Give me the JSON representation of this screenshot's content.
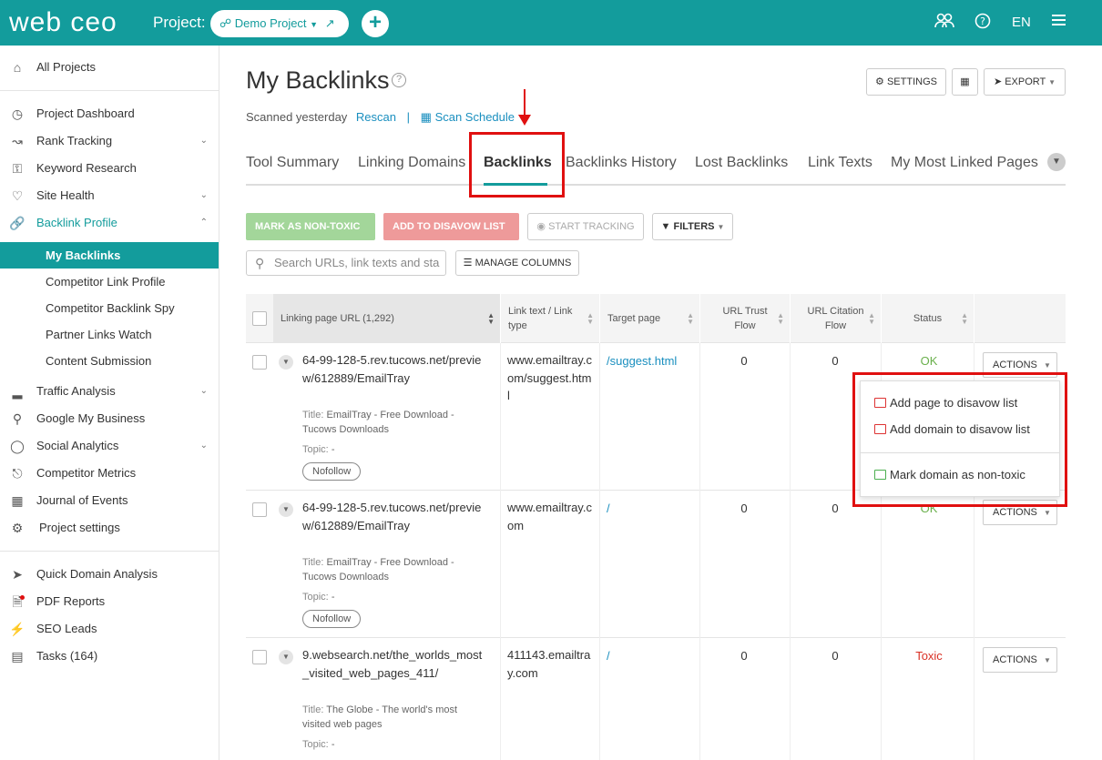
{
  "header": {
    "logo": "web ceo",
    "project_label": "Project:",
    "project_name": "Demo Project",
    "add_label": "+",
    "lang": "EN",
    "brand_color": "#139c9c"
  },
  "sidebar": {
    "all_projects": "All Projects",
    "items": [
      {
        "label": "Project Dashboard",
        "icon": "dashboard-icon"
      },
      {
        "label": "Rank Tracking",
        "icon": "chart-line-icon"
      },
      {
        "label": "Keyword Research",
        "icon": "key-icon"
      },
      {
        "label": "Site Health",
        "icon": "heartbeat-icon"
      },
      {
        "label": "Backlink Profile",
        "icon": "link-icon"
      }
    ],
    "sub_items": [
      "My Backlinks",
      "Competitor Link Profile",
      "Competitor Backlink Spy",
      "Partner Links Watch",
      "Content Submission"
    ],
    "items2": [
      {
        "label": "Traffic Analysis",
        "icon": "bar-chart-icon"
      },
      {
        "label": "Google My Business",
        "icon": "location-pin-icon"
      },
      {
        "label": "Social Analytics",
        "icon": "chat-bubble-icon"
      },
      {
        "label": "Competitor Metrics",
        "icon": "binoculars-icon"
      },
      {
        "label": "Journal of Events",
        "icon": "calendar-icon"
      },
      {
        "label": "Project settings",
        "icon": "gear-icon"
      }
    ],
    "items3": [
      {
        "label": "Quick Domain Analysis",
        "icon": "rocket-icon"
      },
      {
        "label": "PDF Reports",
        "icon": "pdf-icon"
      },
      {
        "label": "SEO Leads",
        "icon": "bolt-icon"
      },
      {
        "label": "Tasks (164)",
        "icon": "tasks-icon"
      }
    ]
  },
  "main": {
    "title": "My Backlinks",
    "settings": "SETTINGS",
    "export": "EXPORT",
    "scanned": "Scanned yesterday",
    "rescan": "Rescan",
    "separator": "|",
    "scan_schedule": "Scan Schedule",
    "tabs": [
      "Tool Summary",
      "Linking Domains",
      "Backlinks",
      "Backlinks History",
      "Lost Backlinks",
      "Link Texts",
      "My Most Linked Pages"
    ],
    "mark_non_toxic": "MARK AS NON-TOXIC",
    "add_disavow": "ADD TO DISAVOW LIST",
    "start_tracking": "START TRACKING",
    "filters": "FILTERS",
    "search_placeholder": "Search URLs, link texts and sta",
    "manage_columns": "MANAGE COLUMNS"
  },
  "table": {
    "headers": [
      "Linking page URL (1,292)",
      "Link text / Link type",
      "Target page",
      "URL Trust Flow",
      "URL Citation Flow",
      "Status"
    ],
    "rows": [
      {
        "url": "64-99-128-5.rev.tucows.net/preview/612889/EmailTray",
        "title_label": "Title:",
        "title": "EmailTray - Free Download - Tucows Downloads",
        "topic_label": "Topic:",
        "topic": "-",
        "tag": "Nofollow",
        "link_text": "www.emailtray.com/suggest.html",
        "target": "/suggest.html",
        "trust": "0",
        "citation": "0",
        "status": "OK",
        "actions": "ACTIONS"
      },
      {
        "url": "64-99-128-5.rev.tucows.net/preview/612889/EmailTray",
        "title_label": "Title:",
        "title": "EmailTray - Free Download - Tucows Downloads",
        "topic_label": "Topic:",
        "topic": "-",
        "tag": "Nofollow",
        "link_text": "www.emailtray.com",
        "target": "/",
        "trust": "0",
        "citation": "0",
        "status": "OK",
        "actions": "ACTIONS"
      },
      {
        "url": "9.websearch.net/the_worlds_most_visited_web_pages_411/",
        "title_label": "Title:",
        "title": "The Globe - The world's most visited web pages",
        "topic_label": "Topic:",
        "topic": "-",
        "link_text": "411143.emailtray.com",
        "target": "/",
        "trust": "0",
        "citation": "0",
        "status": "Toxic",
        "actions": "ACTIONS"
      }
    ]
  },
  "dropdown": {
    "items": [
      "Add page to disavow list",
      "Add domain to disavow list",
      "Mark domain as non-toxic"
    ]
  }
}
